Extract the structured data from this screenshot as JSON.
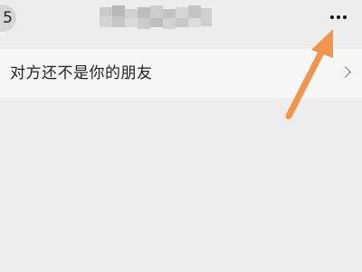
{
  "header": {
    "back_label": "5",
    "more_icon": "more-dots-icon"
  },
  "notice": {
    "text": "对方还不是你的朋友",
    "chevron_icon": "chevron-right-icon"
  },
  "colors": {
    "background": "#ededed",
    "row_background": "#f7f7f7",
    "annotation_arrow": "#f0944e"
  }
}
